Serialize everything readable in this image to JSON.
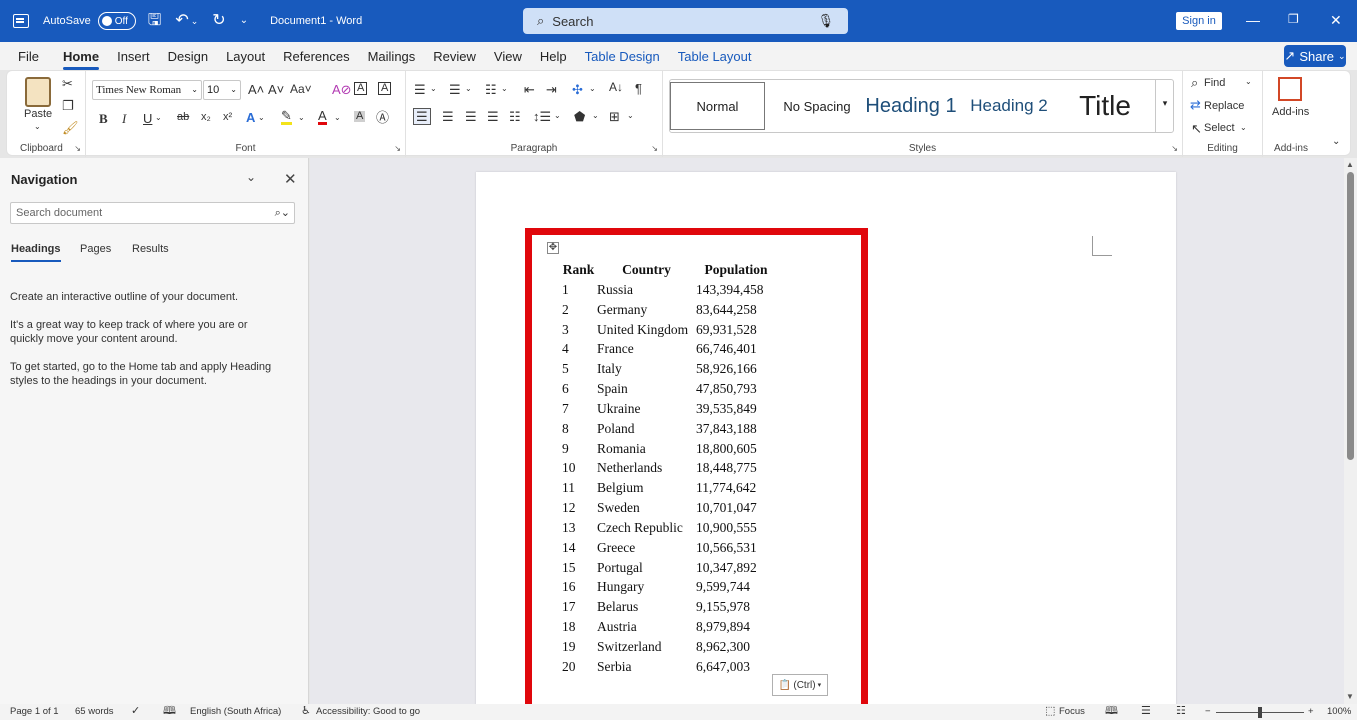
{
  "titlebar": {
    "autosave_label": "AutoSave",
    "autosave_state": "Off",
    "doc_title": "Document1  -  Word",
    "search_placeholder": "Search",
    "signin_label": "Sign in"
  },
  "menu": {
    "tabs": [
      "File",
      "Home",
      "Insert",
      "Design",
      "Layout",
      "References",
      "Mailings",
      "Review",
      "View",
      "Help",
      "Table Design",
      "Table Layout"
    ],
    "active_tab": "Home",
    "share_label": "Share"
  },
  "ribbon": {
    "clipboard": {
      "paste_label": "Paste",
      "group_label": "Clipboard"
    },
    "font": {
      "font_name": "Times New Roman",
      "font_size": "10",
      "group_label": "Font"
    },
    "paragraph": {
      "group_label": "Paragraph"
    },
    "styles": {
      "items": [
        "Normal",
        "No Spacing",
        "Heading 1",
        "Heading 2",
        "Title"
      ],
      "group_label": "Styles"
    },
    "editing": {
      "find_label": "Find",
      "replace_label": "Replace",
      "select_label": "Select",
      "group_label": "Editing"
    },
    "addins": {
      "button_label": "Add-ins",
      "group_label": "Add-ins"
    }
  },
  "navigation": {
    "title": "Navigation",
    "search_placeholder": "Search document",
    "tabs": [
      "Headings",
      "Pages",
      "Results"
    ],
    "active_tab": "Headings",
    "paragraphs": [
      "Create an interactive outline of your document.",
      "It's a great way to keep track of where you are or quickly move your content around.",
      "To get started, go to the Home tab and apply Heading styles to the headings in your document."
    ]
  },
  "document": {
    "table": {
      "headers": [
        "Rank",
        "Country",
        "Population"
      ],
      "rows": [
        [
          "1",
          "Russia",
          "143,394,458"
        ],
        [
          "2",
          "Germany",
          "83,644,258"
        ],
        [
          "3",
          "United Kingdom",
          "69,931,528"
        ],
        [
          "4",
          "France",
          "66,746,401"
        ],
        [
          "5",
          "Italy",
          "58,926,166"
        ],
        [
          "6",
          "Spain",
          "47,850,793"
        ],
        [
          "7",
          "Ukraine",
          "39,535,849"
        ],
        [
          "8",
          "Poland",
          "37,843,188"
        ],
        [
          "9",
          "Romania",
          "18,800,605"
        ],
        [
          "10",
          "Netherlands",
          "18,448,775"
        ],
        [
          "11",
          "Belgium",
          "11,774,642"
        ],
        [
          "12",
          "Sweden",
          "10,701,047"
        ],
        [
          "13",
          "Czech Republic",
          "10,900,555"
        ],
        [
          "14",
          "Greece",
          "10,566,531"
        ],
        [
          "15",
          "Portugal",
          "10,347,892"
        ],
        [
          "16",
          "Hungary",
          "9,599,744"
        ],
        [
          "17",
          "Belarus",
          "9,155,978"
        ],
        [
          "18",
          "Austria",
          "8,979,894"
        ],
        [
          "19",
          "Switzerland",
          "8,962,300"
        ],
        [
          "20",
          "Serbia",
          "6,647,003"
        ]
      ]
    },
    "paste_options_label": "(Ctrl)",
    "highlight_color": "#e0070c"
  },
  "statusbar": {
    "page": "Page 1 of 1",
    "words": "65 words",
    "language": "English (South Africa)",
    "accessibility": "Accessibility: Good to go",
    "focus": "Focus",
    "zoom": "100%"
  },
  "colors": {
    "brand": "#185abd"
  }
}
